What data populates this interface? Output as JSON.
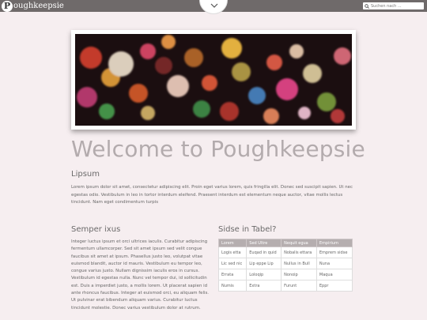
{
  "header": {
    "logo_letter": "P",
    "logo_text": "oughkeepsie",
    "search_placeholder": "Suchen nach ..."
  },
  "main": {
    "title": "Welcome to Poughkeepsie",
    "lipsum": {
      "heading": "Lipsum",
      "text": "Lorem ipsum dolor sit amet, consectetur adipiscing elit. Proin eget varius lorem, quis fringilla elit. Donec sed suscipit sapien. Ut nec egestas odio. Vestibulum in leo in tortor interdum eleifend. Praesent interdum est elementum neque auctor, vitae mollis lectus tincidunt. Nam eget condimentum turpis"
    },
    "semper": {
      "heading": "Semper ixus",
      "text": "Integer luctus ipsum et orci ultrices iaculis. Curabitur adipiscing fermentum ullamcorper. Sed sit amet ipsum sed velit congue faucibus sit amet at ipsum. Phasellus justo leo, volutpat vitae euismod blandit, auctor id mauris. Vestibulum eu tempor leo, congue varius justo. Nullam dignissim iaculis eros in cursus. Vestibulum id egestas nulla. Nunc vel tempor dui, id sollicitudin est. Duis a imperdiet justo, a mollis lorem. Ut placerat sapien id ante rhoncus faucibus. Integer at euismod orci, eu aliquam felis. Ut pulvinar erat bibendum aliquam varius. Curabitur luctus tincidunt molestie. Donec varius vestibulum dolor at rutrum."
    },
    "tabel": {
      "heading": "Sidse in Tabel?",
      "columns": [
        "Lorem",
        "Sed Ultre",
        "Nequit egua",
        "Empirium"
      ],
      "rows": [
        [
          "Logis etta",
          "Euqad in quid",
          "Nobalis ettara",
          "Emprem sidse"
        ],
        [
          "Lic sed nic",
          "Lip eppe Lip",
          "Nullus in Bull",
          "Nuna"
        ],
        [
          "Errata",
          "Loloqip",
          "Nonoip",
          "Maqua"
        ],
        [
          "Numis",
          "Extra",
          "Furunt",
          "Eppr"
        ]
      ]
    }
  },
  "colors": {
    "topbar": "#6f6a6a",
    "background": "#f6eef0",
    "title": "#b3abad",
    "table_header": "#b5aeaf"
  }
}
